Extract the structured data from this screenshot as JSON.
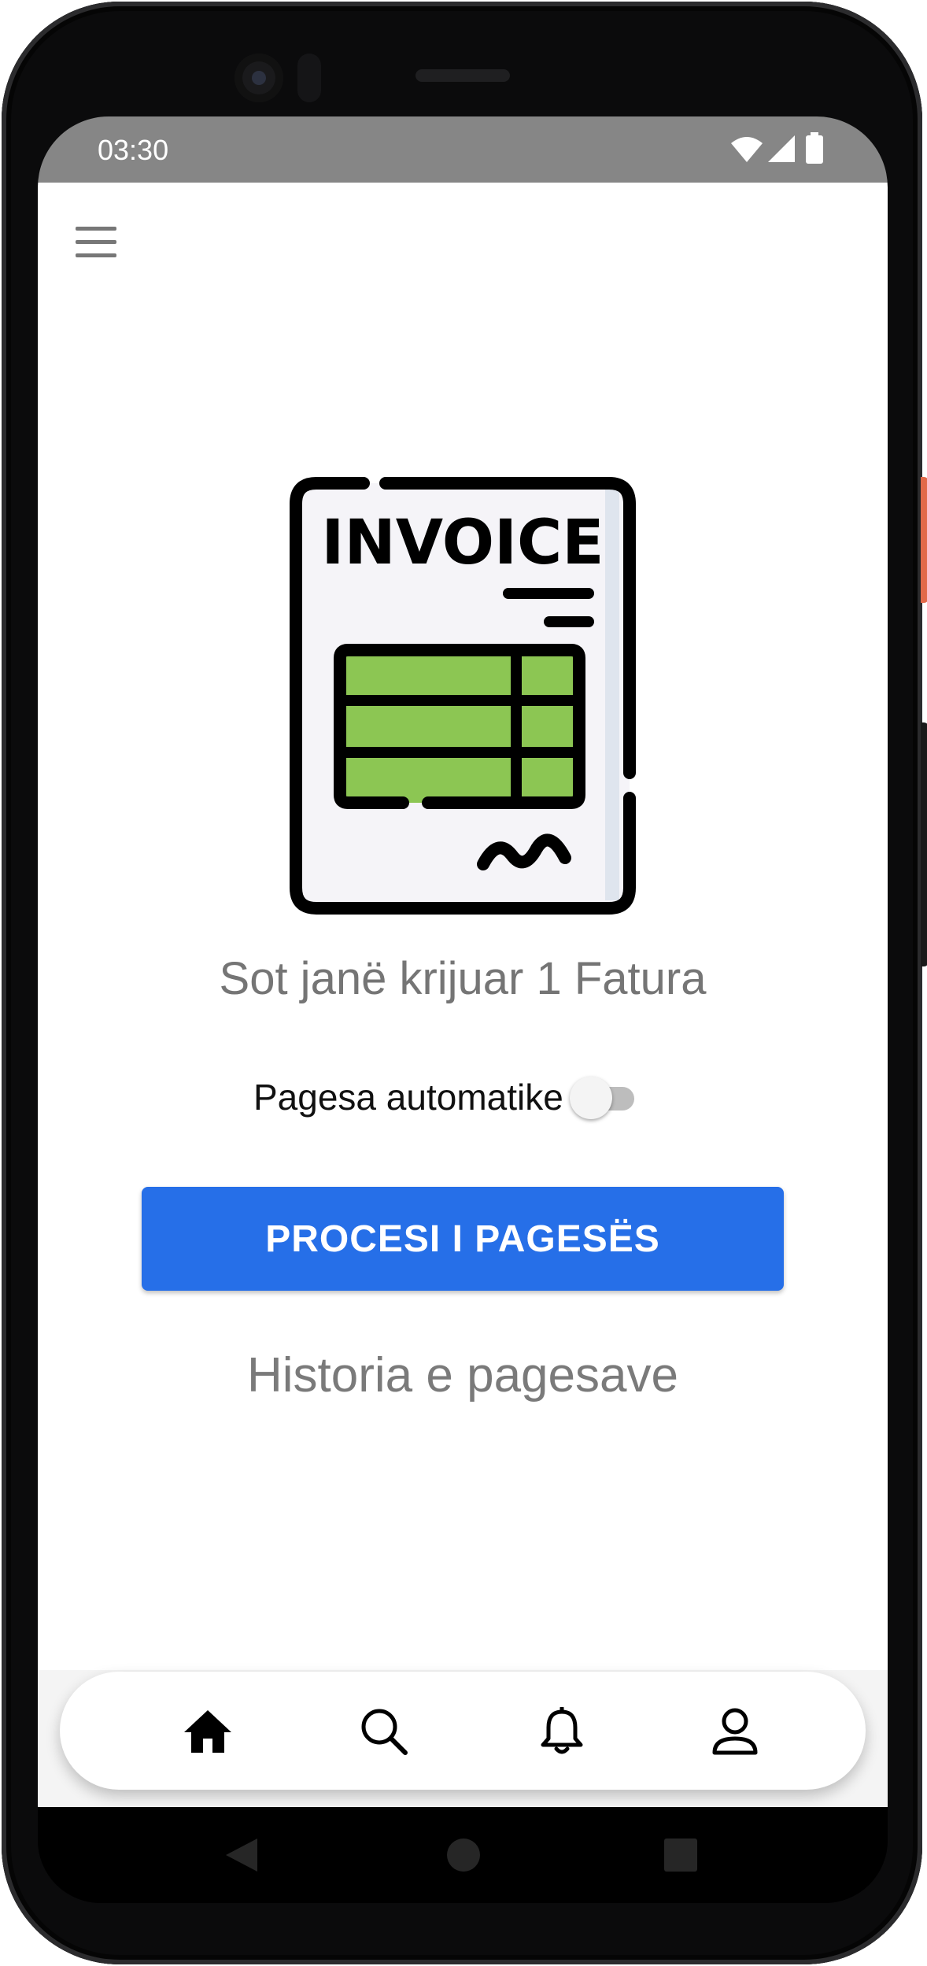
{
  "status_bar": {
    "time": "03:30"
  },
  "invoice_illustration": {
    "text": "INVOICE",
    "icon": "invoice-icon"
  },
  "main": {
    "headline": "Sot janë krijuar 1 Fatura",
    "toggle_label": "Pagesa automatike",
    "toggle_on": false,
    "cta_label": "PROCESI I PAGESËS",
    "history_link": "Historia e pagesave"
  },
  "bottom_nav": {
    "items": [
      "home-icon",
      "search-icon",
      "bell-icon",
      "user-icon"
    ],
    "active": "home-icon"
  },
  "colors": {
    "accent": "#266fe8",
    "status_bar": "#868686",
    "invoice_green": "#8cc653",
    "headline": "#757575"
  }
}
